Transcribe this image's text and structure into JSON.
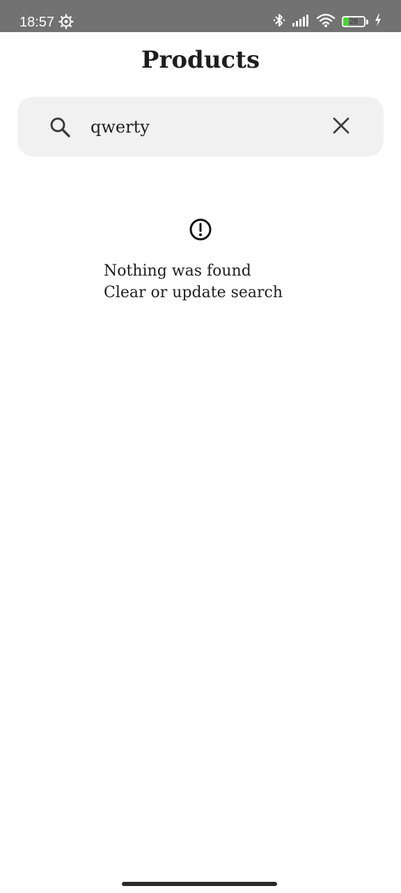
{
  "status_bar": {
    "time": "18:57",
    "battery_level": "28",
    "battery_fraction": 0.28,
    "battery_fill_color": "#4cd137",
    "icons": [
      "gear-icon",
      "bluetooth-icon",
      "signal-icon",
      "wifi-icon",
      "battery-icon",
      "charging-icon"
    ]
  },
  "header": {
    "title": "Products"
  },
  "search": {
    "value": "qwerty",
    "placeholder": "",
    "search_icon": "search-icon",
    "clear_icon": "close-icon"
  },
  "empty_state": {
    "icon": "alert-circle-icon",
    "line1": "Nothing was found",
    "line2": "Clear or update search"
  }
}
